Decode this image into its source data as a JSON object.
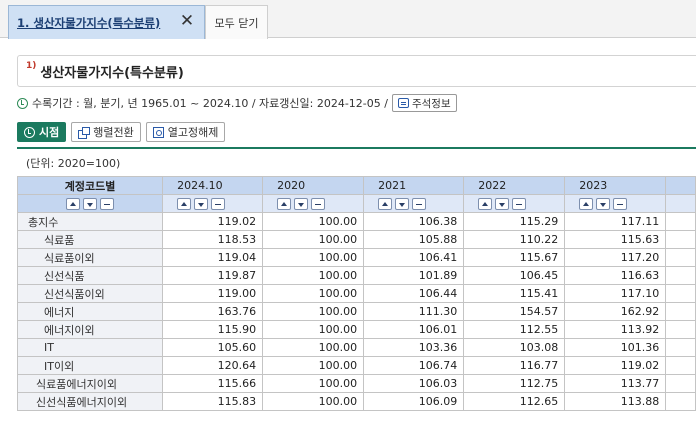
{
  "tabs": {
    "active_label": "1. 생산자물가지수(특수분류)",
    "close_glyph": "✕",
    "close_all_label": "모두 닫기"
  },
  "title": {
    "footnote_marker": "1)",
    "text": "생산자물가지수(특수분류)"
  },
  "info": {
    "period_text": "수록기간 : 월, 분기, 년 1965.01 ~ 2024.10 / 자료갱신일: 2024-12-05 /",
    "note_button_label": "주석정보"
  },
  "toolbar": {
    "time_label": "시점",
    "pivot_label": "행렬전환",
    "season_label": "열고정해제"
  },
  "unit_text": "(단위: 2020=100)",
  "table": {
    "corner_label": "계정코드별",
    "columns": [
      "2024.10",
      "2020",
      "2021",
      "2022",
      "2023"
    ],
    "rows": [
      {
        "label": "총지수",
        "level": 0,
        "values": [
          "119.02",
          "100.00",
          "106.38",
          "115.29",
          "117.11"
        ]
      },
      {
        "label": "식료품",
        "level": 1,
        "values": [
          "118.53",
          "100.00",
          "105.88",
          "110.22",
          "115.63"
        ]
      },
      {
        "label": "식료품이외",
        "level": 1,
        "values": [
          "119.04",
          "100.00",
          "106.41",
          "115.67",
          "117.20"
        ]
      },
      {
        "label": "신선식품",
        "level": 1,
        "values": [
          "119.87",
          "100.00",
          "101.89",
          "106.45",
          "116.63"
        ]
      },
      {
        "label": "신선식품이외",
        "level": 1,
        "values": [
          "119.00",
          "100.00",
          "106.44",
          "115.41",
          "117.10"
        ]
      },
      {
        "label": "에너지",
        "level": 1,
        "values": [
          "163.76",
          "100.00",
          "111.30",
          "154.57",
          "162.92"
        ]
      },
      {
        "label": "에너지이외",
        "level": 1,
        "values": [
          "115.90",
          "100.00",
          "106.01",
          "112.55",
          "113.92"
        ]
      },
      {
        "label": "IT",
        "level": 1,
        "values": [
          "105.60",
          "100.00",
          "103.36",
          "103.08",
          "101.36"
        ]
      },
      {
        "label": "IT이외",
        "level": 1,
        "values": [
          "120.64",
          "100.00",
          "106.74",
          "116.77",
          "119.02"
        ]
      },
      {
        "label": "식료품에너지이외",
        "level": 2,
        "values": [
          "115.66",
          "100.00",
          "106.03",
          "112.75",
          "113.77"
        ]
      },
      {
        "label": "신선식품에너지이외",
        "level": 2,
        "values": [
          "115.83",
          "100.00",
          "106.09",
          "112.65",
          "113.88"
        ]
      }
    ]
  }
}
